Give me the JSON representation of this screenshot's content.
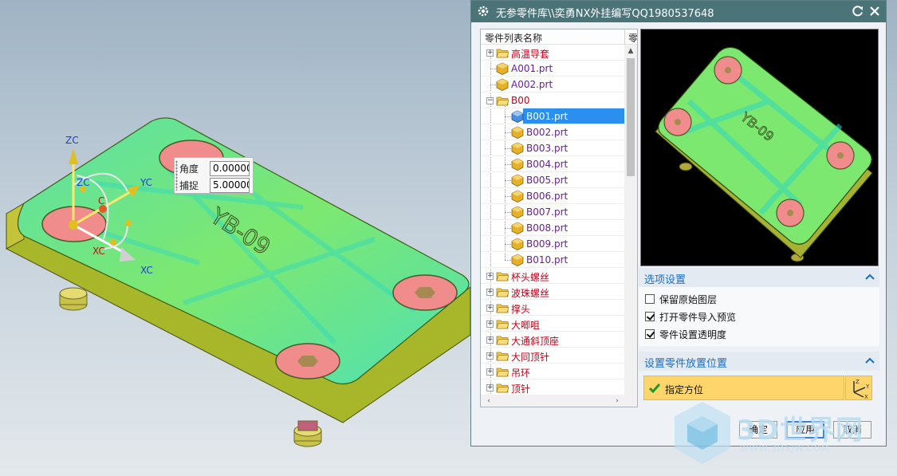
{
  "dialog": {
    "title": "无参零件库\\\\奕勇NX外挂编写QQ1980537648",
    "colors": {
      "titlebar": "#4a7478",
      "section_head": "#1a6ec2",
      "highlight": "#fdd56b"
    }
  },
  "tree": {
    "header": {
      "name": "零件列表名称",
      "col2": "零"
    },
    "items": [
      {
        "label": "高温导套",
        "type": "folder",
        "level": 0,
        "expanded": false
      },
      {
        "label": "A001.prt",
        "type": "part",
        "level": 1
      },
      {
        "label": "A002.prt",
        "type": "part",
        "level": 1
      },
      {
        "label": "B00",
        "type": "folder",
        "level": 0,
        "expanded": true
      },
      {
        "label": "B001.prt",
        "type": "part",
        "level": 2,
        "selected": true
      },
      {
        "label": "B002.prt",
        "type": "part",
        "level": 2
      },
      {
        "label": "B003.prt",
        "type": "part",
        "level": 2
      },
      {
        "label": "B004.prt",
        "type": "part",
        "level": 2
      },
      {
        "label": "B005.prt",
        "type": "part",
        "level": 2
      },
      {
        "label": "B006.prt",
        "type": "part",
        "level": 2
      },
      {
        "label": "B007.prt",
        "type": "part",
        "level": 2
      },
      {
        "label": "B008.prt",
        "type": "part",
        "level": 2
      },
      {
        "label": "B009.prt",
        "type": "part",
        "level": 2
      },
      {
        "label": "B010.prt",
        "type": "part",
        "level": 2
      },
      {
        "label": "杯头螺丝",
        "type": "folder",
        "level": 0
      },
      {
        "label": "波珠螺丝",
        "type": "folder",
        "level": 0
      },
      {
        "label": "撑头",
        "type": "folder",
        "level": 0
      },
      {
        "label": "大唧咀",
        "type": "folder",
        "level": 0
      },
      {
        "label": "大通斜顶座",
        "type": "folder",
        "level": 0
      },
      {
        "label": "大同顶针",
        "type": "folder",
        "level": 0
      },
      {
        "label": "吊环",
        "type": "folder",
        "level": 0
      },
      {
        "label": "顶针",
        "type": "folder",
        "level": 0
      }
    ]
  },
  "options": {
    "title": "选项设置",
    "checkboxes": [
      {
        "label": "保留原始图层",
        "checked": false
      },
      {
        "label": "打开零件导入预览",
        "checked": true
      },
      {
        "label": "零件设置透明度",
        "checked": true
      }
    ]
  },
  "placement": {
    "title": "设置零件放置位置",
    "orient_label": "指定方位"
  },
  "buttons": {
    "ok": "确定",
    "apply": "应用",
    "cancel": "取消"
  },
  "viewport": {
    "part_text": "YB-09",
    "axes": {
      "zc": "ZC",
      "yc": "YC",
      "xc": "XC",
      "xc_small": "XC",
      "c": "C",
      "zc_small": "ZC"
    },
    "popup": {
      "angle_label": "角度",
      "angle_value": "0.00000",
      "snap_label": "捕捉",
      "snap_value": "5.00000"
    }
  },
  "watermark": {
    "main": "3D世界网",
    "sub": "WWW.3DSJW.COM"
  }
}
